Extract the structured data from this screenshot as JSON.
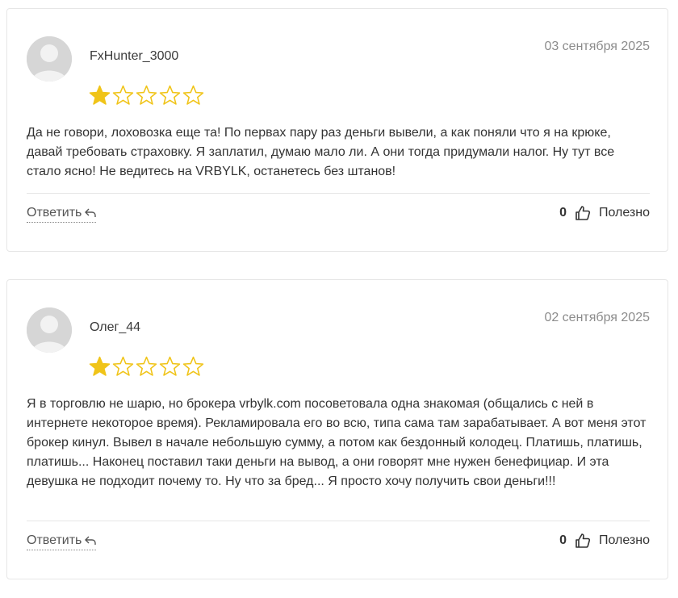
{
  "colors": {
    "star": "#f0c419",
    "muted": "#8c8c8c"
  },
  "reviews": [
    {
      "author": "FxHunter_3000",
      "date": "03 сентября 2025",
      "rating": 1,
      "max_rating": 5,
      "text": "Да не говори, лоховозка еще та! По первах пару раз деньги вывели, а как поняли что я на крюке, давай требовать страховку. Я заплатил, думаю мало ли. А они тогда придумали налог. Ну тут все стало ясно! Не ведитесь на VRBYLK, останетесь без штанов!",
      "reply_label": "Ответить",
      "helpful_count": "0",
      "helpful_label": "Полезно"
    },
    {
      "author": "Олег_44",
      "date": "02 сентября 2025",
      "rating": 1,
      "max_rating": 5,
      "text": "Я в торговлю не шарю, но брокера vrbylk.com посоветовала одна знакомая (общались с ней в интернете некоторое время). Рекламировала его во всю, типа сама там зарабатывает. А вот меня этот брокер кинул. Вывел в начале небольшую сумму, а потом как бездонный колодец. Платишь, платишь, платишь... Наконец поставил таки деньги на вывод, а они говорят мне нужен бенефициар. И эта девушка не подходит почему то. Ну что за бред... Я просто хочу получить свои деньги!!!",
      "reply_label": "Ответить",
      "helpful_count": "0",
      "helpful_label": "Полезно"
    }
  ]
}
